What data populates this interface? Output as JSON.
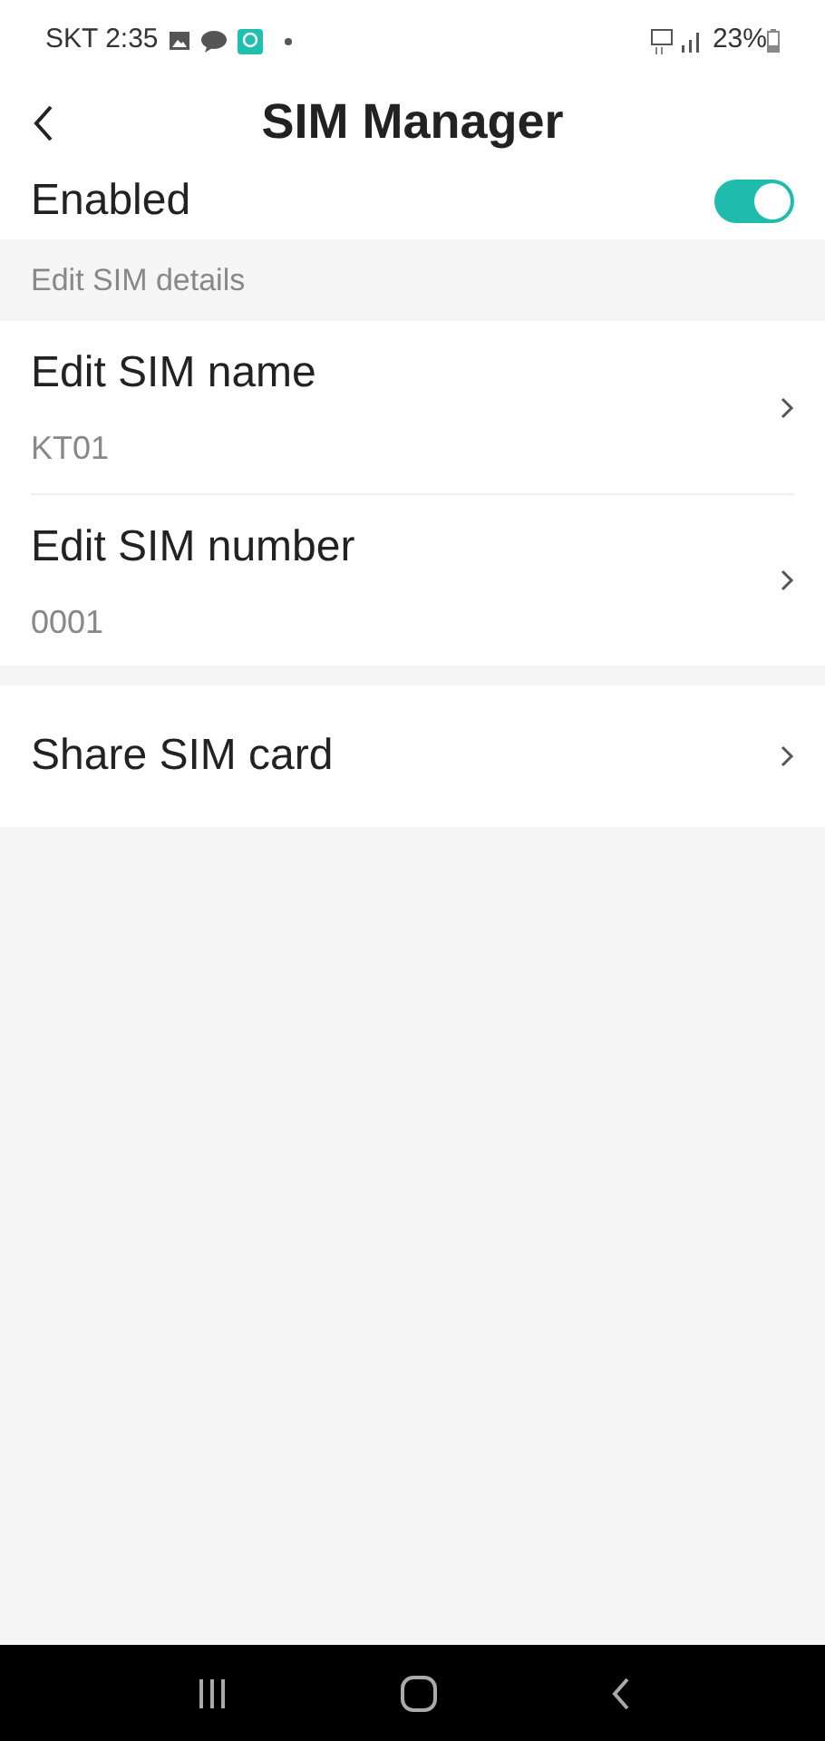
{
  "status_bar": {
    "carrier_time": "SKT 2:35",
    "battery": "23%"
  },
  "header": {
    "title": "SIM Manager"
  },
  "enabled": {
    "label": "Enabled",
    "on": true
  },
  "section": {
    "title": "Edit SIM details"
  },
  "items": [
    {
      "title": "Edit SIM name",
      "value": "KT01"
    },
    {
      "title": "Edit SIM number",
      "value": "0001"
    }
  ],
  "share": {
    "title": "Share SIM card"
  }
}
